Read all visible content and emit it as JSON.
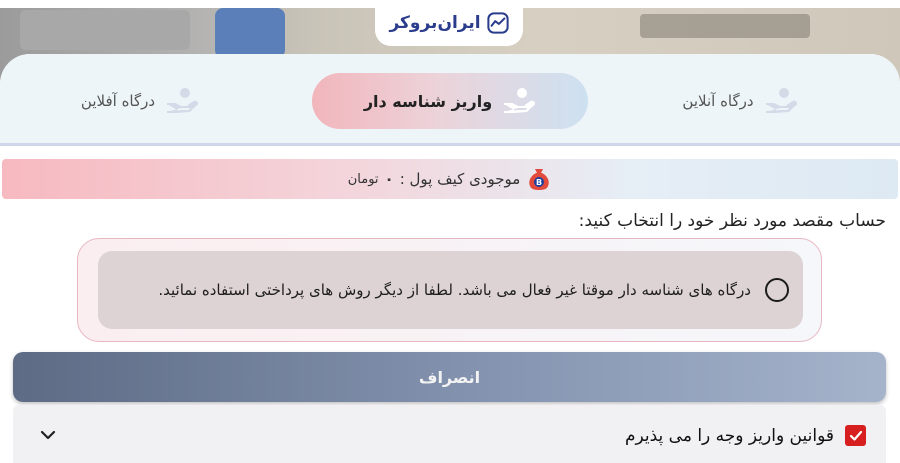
{
  "logo": {
    "text": "ایران‌بروکر",
    "icon": "chart-line-icon"
  },
  "tabs": [
    {
      "label": "درگاه آنلاین",
      "icon": "hand-coin-icon",
      "active": false
    },
    {
      "label": "واریز شناسه دار",
      "icon": "hand-coin-icon",
      "active": true
    },
    {
      "label": "درگاه آفلاین",
      "icon": "hand-coin-icon",
      "active": false
    }
  ],
  "wallet": {
    "label": "موجودی کیف پول :",
    "value": "۰",
    "unit": "تومان",
    "icon": "money-bag-icon"
  },
  "select_label": "حساب مقصد مورد نظر خود را انتخاب کنید:",
  "option": {
    "text": "درگاه های شناسه دار موقتا غیر فعال می باشد. لطفا از دیگر روش های پرداختی استفاده نمائید.",
    "selected": false
  },
  "cancel_label": "انصراف",
  "rules": {
    "label": "قوانین واریز وجه را می پذیرم",
    "checked": true,
    "icon": "chevron-down-icon"
  },
  "colors": {
    "brand": "#2a3c8c",
    "accent": "#d71f1f",
    "button": "#8594b0"
  }
}
